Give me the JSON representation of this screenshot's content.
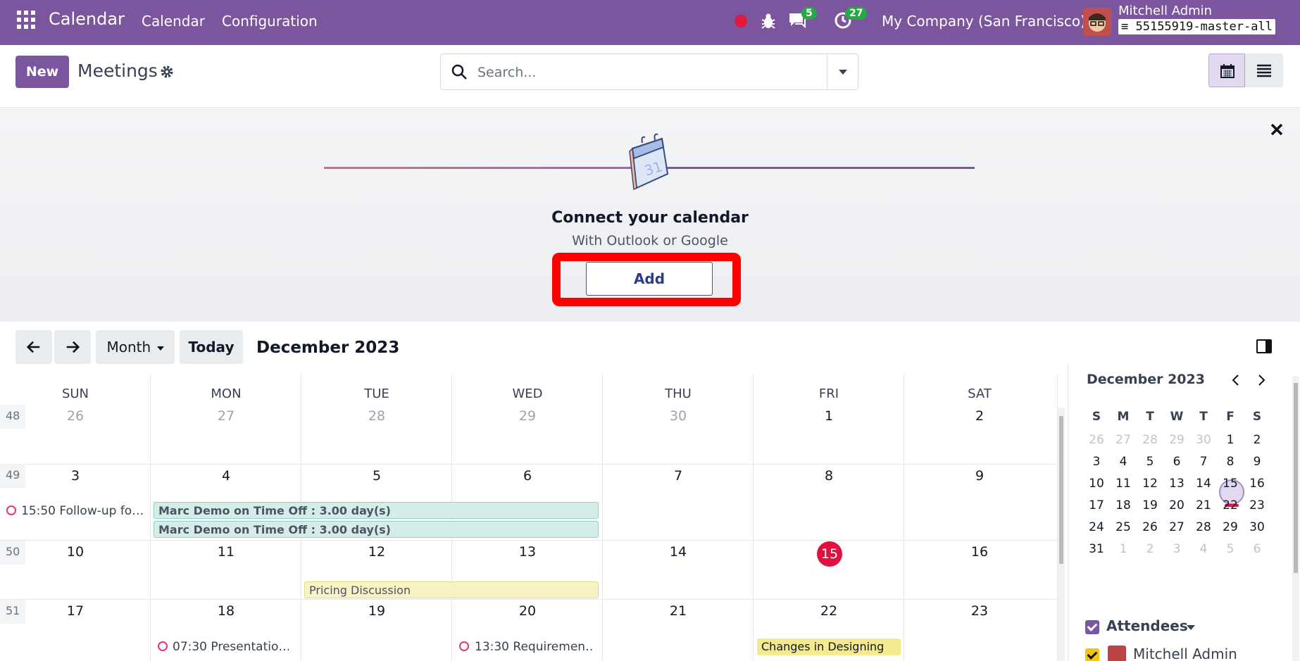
{
  "navbar": {
    "app_name": "Calendar",
    "menu": [
      "Calendar",
      "Configuration"
    ],
    "chat_count": "5",
    "activity_count": "27",
    "company": "My Company (San Francisco)",
    "user_name": "Mitchell Admin",
    "database": "55155919-master-all",
    "brand_color": "#7c559f"
  },
  "control": {
    "new_label": "New",
    "title": "Meetings",
    "search_placeholder": "Search..."
  },
  "banner": {
    "illustration_day": "31",
    "title": "Connect your calendar",
    "subtitle": "With Outlook or Google",
    "add_label": "Add"
  },
  "toolbar": {
    "prev_icon": "arrow-left-icon",
    "next_icon": "arrow-right-icon",
    "scale_label": "Month",
    "today_label": "Today",
    "period_title": "December 2023"
  },
  "grid": {
    "weekdays": [
      "SUN",
      "MON",
      "TUE",
      "WED",
      "THU",
      "FRI",
      "SAT"
    ],
    "weeks": [
      {
        "num": "48",
        "days": [
          "26",
          "27",
          "28",
          "29",
          "30",
          "1",
          "2"
        ]
      },
      {
        "num": "49",
        "days": [
          "3",
          "4",
          "5",
          "6",
          "7",
          "8",
          "9"
        ]
      },
      {
        "num": "50",
        "days": [
          "10",
          "11",
          "12",
          "13",
          "14",
          "15",
          "16"
        ]
      },
      {
        "num": "51",
        "days": [
          "17",
          "18",
          "19",
          "20",
          "21",
          "22",
          "23"
        ]
      }
    ],
    "events": {
      "followup": "15:50 Follow-up fo…",
      "timeoff1_name": "Marc Demo on Time Off",
      "timeoff1_detail": " : 3.00 day(s)",
      "timeoff2_name": "Marc Demo on Time Off",
      "timeoff2_detail": " : 3.00 day(s)",
      "pricing": "Pricing Discussion",
      "presentation": "07:30 Presentatio…",
      "requirement": "13:30 Requiremen…",
      "designing": "Changes in Designing"
    }
  },
  "sidebar": {
    "mini_title": "December 2023",
    "weekday_initials": [
      "S",
      "M",
      "T",
      "W",
      "T",
      "F",
      "S"
    ],
    "mini_weeks": [
      [
        "26",
        "27",
        "28",
        "29",
        "30",
        "1",
        "2"
      ],
      [
        "3",
        "4",
        "5",
        "6",
        "7",
        "8",
        "9"
      ],
      [
        "10",
        "11",
        "12",
        "13",
        "14",
        "15",
        "16"
      ],
      [
        "17",
        "18",
        "19",
        "20",
        "21",
        "22",
        "23"
      ],
      [
        "24",
        "25",
        "26",
        "27",
        "28",
        "29",
        "30"
      ],
      [
        "31",
        "1",
        "2",
        "3",
        "4",
        "5",
        "6"
      ]
    ],
    "attendees_label": "Attendees",
    "attendee": "Mitchell Admin"
  }
}
